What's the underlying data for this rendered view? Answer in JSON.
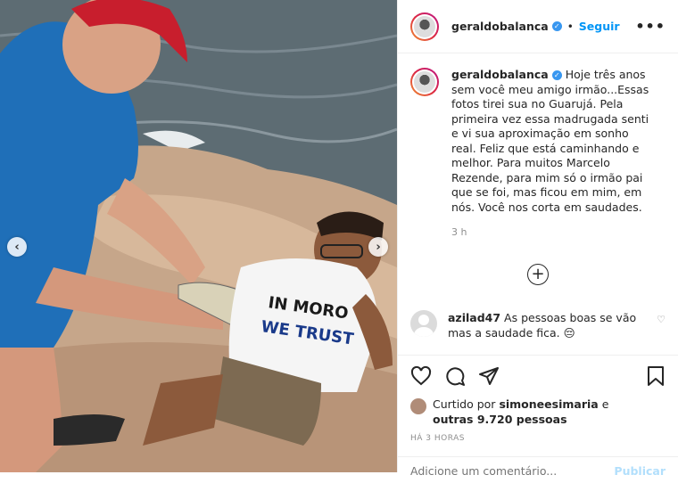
{
  "post": {
    "username": "geraldobalanca",
    "follow_label": "Seguir",
    "separator": "•",
    "more_label": "•••"
  },
  "caption": {
    "username": "geraldobalanca",
    "text": "Hoje três anos sem você meu amigo irmão...Essas fotos tirei sua no Guarujá. Pela primeira vez essa madrugada senti e vi sua aproximação em sonho real. Feliz que está caminhando e melhor. Para muitos Marcelo Rezende, para mim só o irmão pai que se foi, mas ficou em mim, em nós. Você nos corta em saudades.",
    "time": "3 h"
  },
  "comment": {
    "username": "azilad47",
    "text": "As pessoas boas se vão mas a saudade fica. 😔"
  },
  "photo": {
    "shirt_text_line1": "IN MORO",
    "shirt_text_line2": "WE TRUST"
  },
  "likes": {
    "prefix": "Curtido por",
    "user": "simoneesimaria",
    "and": "e",
    "others": "outras 9.720 pessoas"
  },
  "timestamp": "HÁ 3 HORAS",
  "add_comment": {
    "placeholder": "Adicione um comentário...",
    "post_label": "Publicar"
  },
  "nav": {
    "prev": "‹",
    "next": "›"
  }
}
